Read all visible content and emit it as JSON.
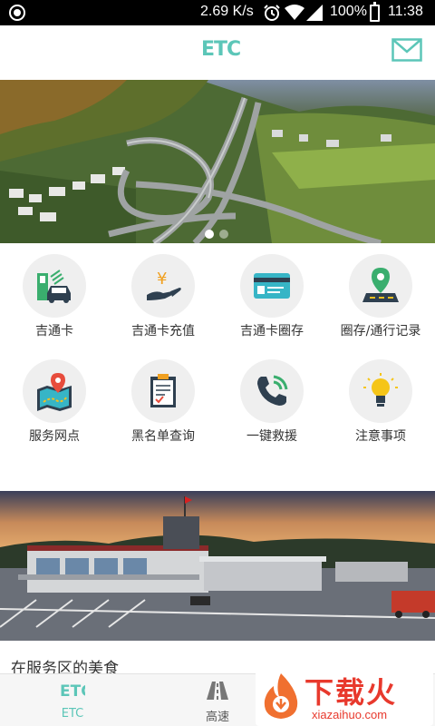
{
  "status_bar": {
    "speed": "2.69 K/s",
    "battery": "100%",
    "time": "11:38"
  },
  "header": {
    "logo": "ETC",
    "mail_icon": "mail-icon",
    "accent_color": "#5cc6b8"
  },
  "banner": {
    "slide_count": 2,
    "active_slide": 1
  },
  "grid": {
    "items": [
      {
        "label": "吉通卡",
        "icon": "etc-car-icon"
      },
      {
        "label": "吉通卡充值",
        "icon": "yen-hand-icon"
      },
      {
        "label": "吉通卡圈存",
        "icon": "id-card-icon"
      },
      {
        "label": "圈存/通行记录",
        "icon": "map-pin-road-icon"
      },
      {
        "label": "服务网点",
        "icon": "map-location-icon"
      },
      {
        "label": "黑名单查询",
        "icon": "clipboard-icon"
      },
      {
        "label": "一键救援",
        "icon": "phone-call-icon"
      },
      {
        "label": "注意事项",
        "icon": "lightbulb-icon"
      }
    ]
  },
  "section": {
    "title": "在服务区的美食"
  },
  "bottom_nav": {
    "items": [
      {
        "label": "ETC",
        "icon": "etc-tab-icon",
        "active": true
      },
      {
        "label": "高速",
        "icon": "highway-road-icon",
        "active": false
      }
    ]
  },
  "watermark": {
    "text": "下载火",
    "url": "xiazaihuo.com"
  }
}
